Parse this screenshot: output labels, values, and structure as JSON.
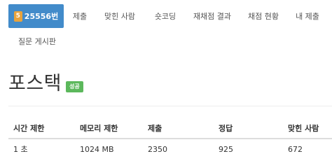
{
  "nav": {
    "tabs": [
      {
        "label": "25556번",
        "badge": "5",
        "active": true
      },
      {
        "label": "제출"
      },
      {
        "label": "맞힌 사람"
      },
      {
        "label": "숏코딩"
      },
      {
        "label": "재채점 결과"
      },
      {
        "label": "채점 현황"
      },
      {
        "label": "내 제출"
      },
      {
        "label": "질문 게시판"
      }
    ]
  },
  "problem": {
    "title": "포스택",
    "status_badge": "성공"
  },
  "table": {
    "headers": [
      "시간 제한",
      "메모리 제한",
      "제출",
      "정답",
      "맞힌 사람"
    ],
    "rows": [
      [
        "1 초",
        "1024 MB",
        "2350",
        "925",
        "672"
      ]
    ]
  },
  "colors": {
    "active_tab": "#428bca",
    "badge_icon": "#e8a33d",
    "success_badge": "#5cb85c"
  }
}
